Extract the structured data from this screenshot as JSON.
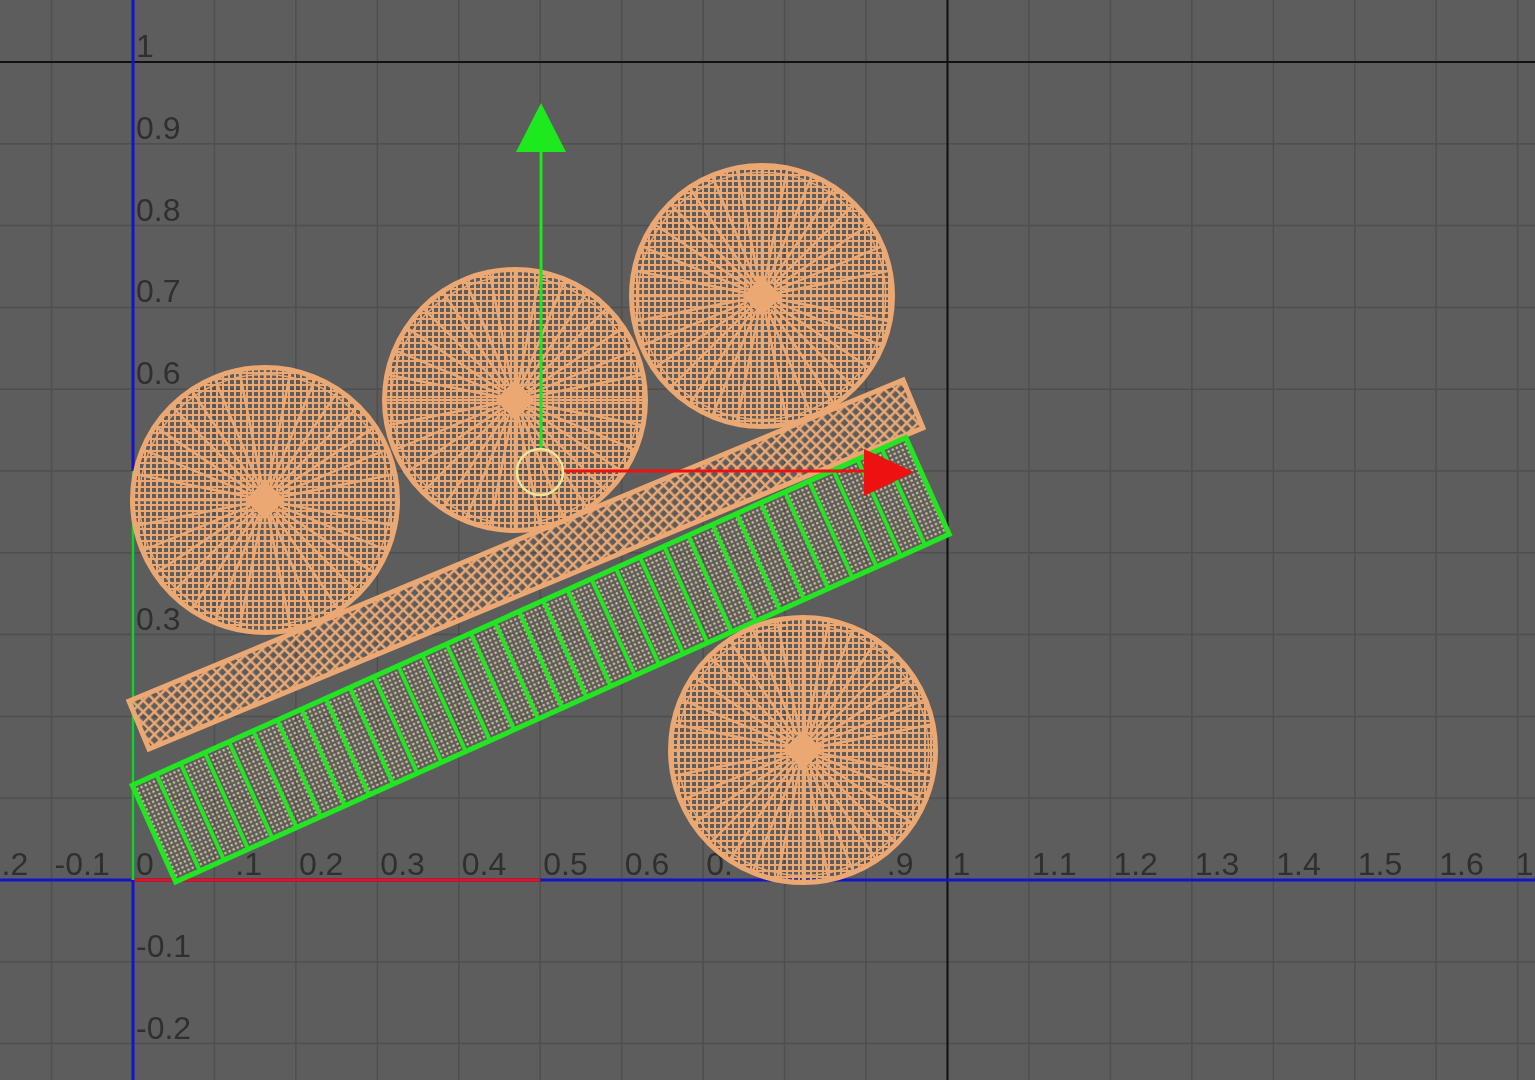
{
  "uv_editor": {
    "u_labels": [
      ".2",
      "-0.1",
      "0",
      ".1",
      "0.2",
      "0.3",
      "0.4",
      "0.5",
      "0.6",
      "0.",
      ".9",
      "1",
      "1.1",
      "1.2",
      "1.3",
      "1.4",
      "1.5",
      "1.6",
      "1"
    ],
    "v_labels": [
      "1",
      "0.9",
      "0.8",
      "0.7",
      "0.6",
      "0.3",
      "-0.1",
      "-0.2"
    ],
    "shells": [
      {
        "kind": "disc",
        "selected": false
      },
      {
        "kind": "disc",
        "selected": false
      },
      {
        "kind": "disc",
        "selected": false
      },
      {
        "kind": "strip",
        "selected": false
      },
      {
        "kind": "strip",
        "selected": true
      },
      {
        "kind": "disc",
        "selected": false
      }
    ]
  }
}
